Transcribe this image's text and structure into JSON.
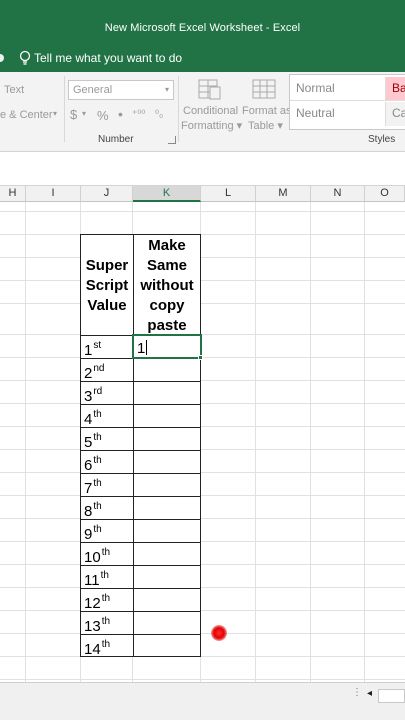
{
  "window": {
    "title": "New Microsoft Excel Worksheet  -  Excel"
  },
  "tell_me": {
    "placeholder": "Tell me what you want to do"
  },
  "ribbon": {
    "wrap_text": "Text",
    "merge_center": "e & Center",
    "number_format": "General",
    "currency_symbol": "$",
    "percent_symbol": "%",
    "comma_symbol": "•",
    "number_group": "Number",
    "conditional_formatting": [
      "Conditional",
      "Formatting ▾"
    ],
    "format_as_table": [
      "Format as",
      "Table ▾"
    ],
    "styles": {
      "normal": "Normal",
      "bad": "Bad",
      "neutral": "Neutral",
      "calc": "Cal"
    },
    "styles_group": "Styles"
  },
  "columns": [
    "H",
    "I",
    "J",
    "K",
    "L",
    "M",
    "N",
    "O"
  ],
  "table": {
    "header_j": [
      "Super",
      "Script",
      "Value"
    ],
    "header_k": [
      "Make",
      "Same",
      "without",
      "copy",
      "paste"
    ],
    "rows": [
      {
        "base": "1",
        "sup": "st"
      },
      {
        "base": "2",
        "sup": "nd"
      },
      {
        "base": "3",
        "sup": "rd"
      },
      {
        "base": "4",
        "sup": "th"
      },
      {
        "base": "5",
        "sup": "th"
      },
      {
        "base": "6",
        "sup": "th"
      },
      {
        "base": "7",
        "sup": "th"
      },
      {
        "base": "8",
        "sup": "th"
      },
      {
        "base": "9",
        "sup": "th"
      },
      {
        "base": "10",
        "sup": "th"
      },
      {
        "base": "11",
        "sup": "th"
      },
      {
        "base": "12",
        "sup": "th"
      },
      {
        "base": "13",
        "sup": "th"
      },
      {
        "base": "14",
        "sup": "th"
      }
    ],
    "editing_value": "1"
  },
  "colors": {
    "excel_green": "#217346",
    "cursor_dot": "#e40000"
  }
}
